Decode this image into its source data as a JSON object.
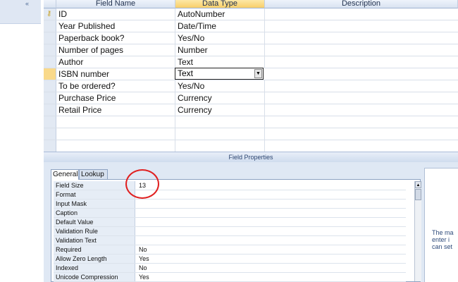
{
  "nav": {
    "collapse_glyph": "«"
  },
  "grid": {
    "headers": {
      "field_name": "Field Name",
      "data_type": "Data Type",
      "description": "Description"
    },
    "rows": [
      {
        "field": "ID",
        "type": "AutoNumber",
        "primary_key": true
      },
      {
        "field": "Year Published",
        "type": "Date/Time"
      },
      {
        "field": "Paperback book?",
        "type": "Yes/No"
      },
      {
        "field": "Number of pages",
        "type": "Number"
      },
      {
        "field": "Author",
        "type": "Text"
      },
      {
        "field": "ISBN number",
        "type": "Text",
        "selected": true
      },
      {
        "field": "To be ordered?",
        "type": "Yes/No"
      },
      {
        "field": "Purchase Price",
        "type": "Currency"
      },
      {
        "field": "Retail Price",
        "type": "Currency"
      }
    ],
    "dropdown_glyph": "▼"
  },
  "field_properties": {
    "title": "Field Properties",
    "tabs": {
      "general": "General",
      "lookup": "Lookup"
    },
    "properties": [
      {
        "label": "Field Size",
        "value": "13"
      },
      {
        "label": "Format",
        "value": ""
      },
      {
        "label": "Input Mask",
        "value": ""
      },
      {
        "label": "Caption",
        "value": ""
      },
      {
        "label": "Default Value",
        "value": ""
      },
      {
        "label": "Validation Rule",
        "value": ""
      },
      {
        "label": "Validation Text",
        "value": ""
      },
      {
        "label": "Required",
        "value": "No"
      },
      {
        "label": "Allow Zero Length",
        "value": "Yes"
      },
      {
        "label": "Indexed",
        "value": "No"
      },
      {
        "label": "Unicode Compression",
        "value": "Yes"
      }
    ],
    "help_lines": [
      "The ma",
      "enter i",
      "can set"
    ],
    "scroll_up_glyph": "▲"
  },
  "colors": {
    "highlight_annotation": "#e02020",
    "selected_row": "#f9d98a",
    "header_selected": "#f8cf69"
  }
}
